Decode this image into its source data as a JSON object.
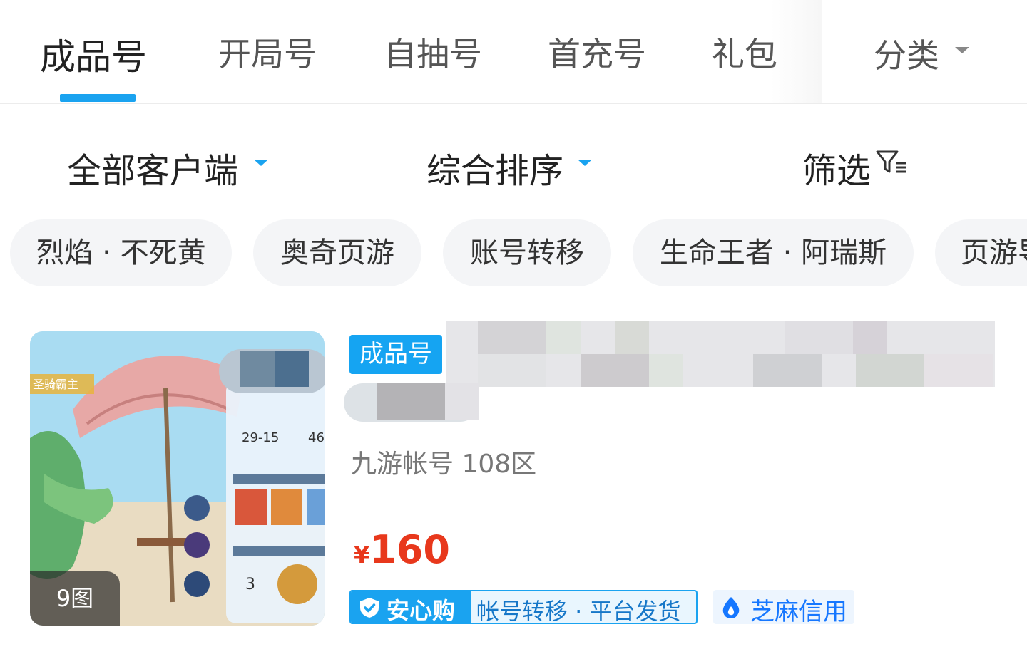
{
  "tabs": [
    {
      "label": "成品号",
      "active": true
    },
    {
      "label": "开局号",
      "active": false
    },
    {
      "label": "自抽号",
      "active": false
    },
    {
      "label": "首充号",
      "active": false
    },
    {
      "label": "礼包",
      "active": false
    }
  ],
  "category": {
    "label": "分类"
  },
  "filters": {
    "client": "全部客户端",
    "sort": "综合排序",
    "screen": "筛选"
  },
  "chips": [
    "烈焰 · 不死黄",
    "奥奇页游",
    "账号转移",
    "生命王者 · 阿瑞斯",
    "页游导"
  ],
  "product": {
    "badge": "成品号",
    "image_count": "9图",
    "server": "九游帐号  108区",
    "currency": "¥",
    "price": "160",
    "assure_brand": "安心购",
    "assure_text": "帐号转移 · 平台发货",
    "credit": "芝麻信用",
    "thumb_texts": {
      "stage": "29-15",
      "stage2": "46",
      "level": "3",
      "banner": "圣骑霸主"
    }
  },
  "colors": {
    "accent": "#1aa3f0",
    "price": "#e8381c",
    "credit": "#1677ff"
  }
}
